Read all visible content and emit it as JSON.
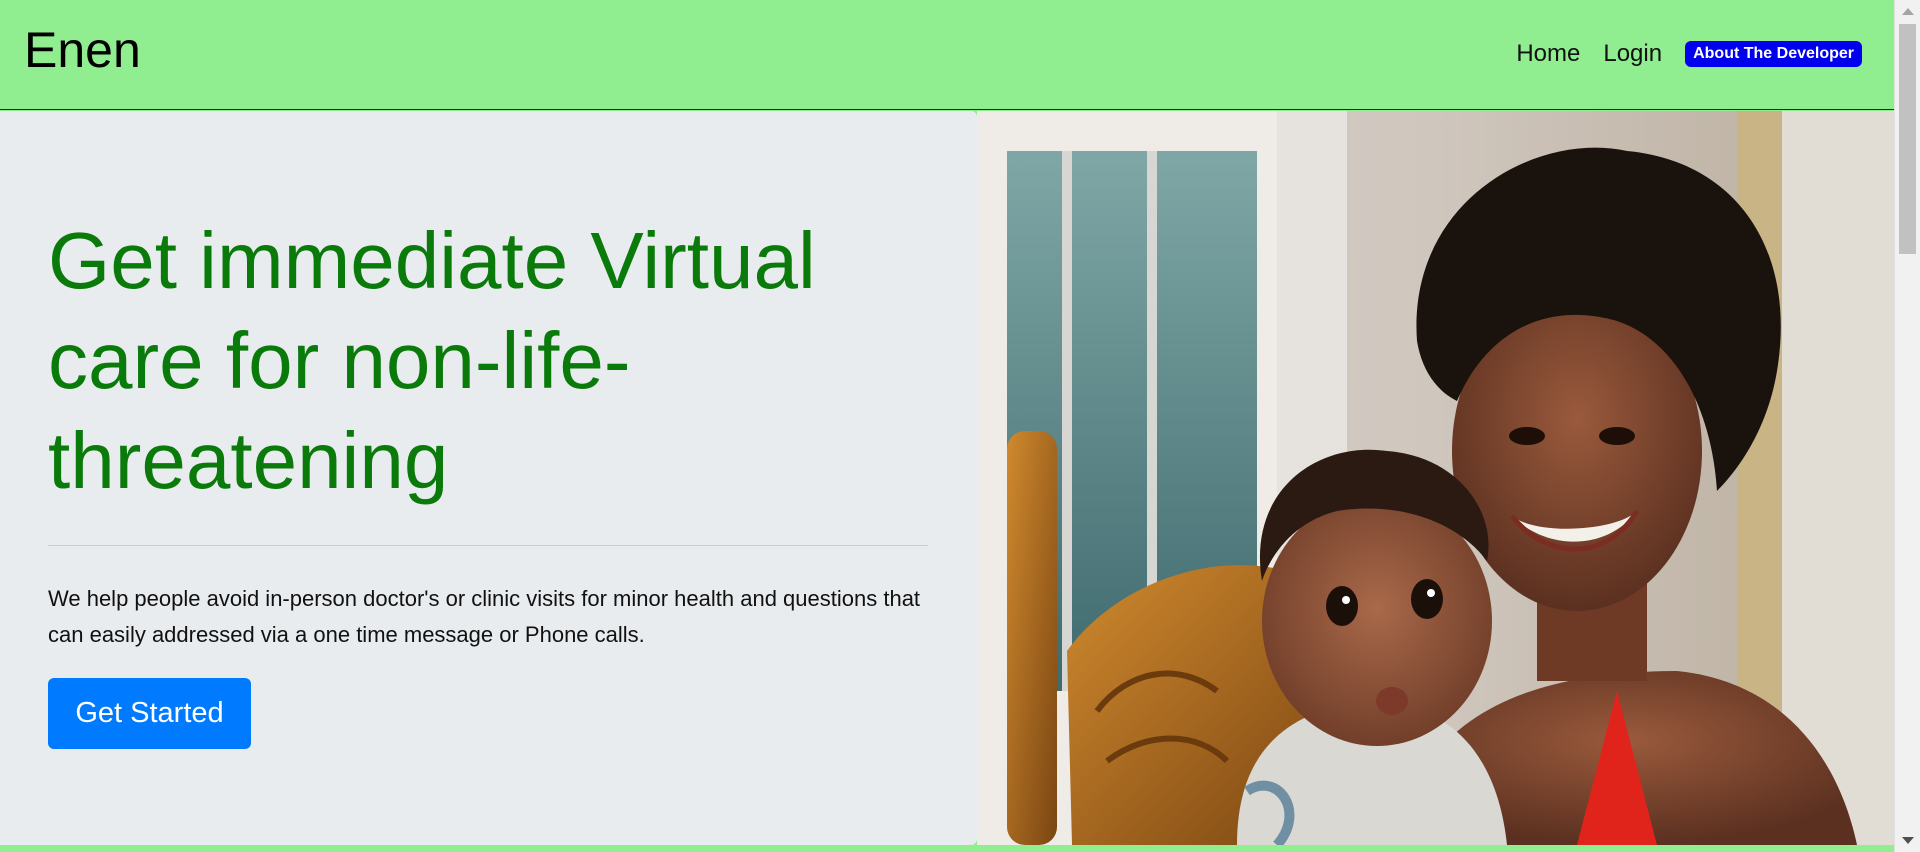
{
  "brand": "Enen",
  "nav": {
    "home": "Home",
    "login": "Login",
    "developer": "About The Developer"
  },
  "hero": {
    "headline": "Get immediate Virtual care for non-life-threatening",
    "lead": "We help people avoid in-person doctor's or clinic visits for minor health and questions that can easily addressed via a one time message or Phone calls.",
    "cta": "Get Started"
  },
  "image": {
    "subject": "mother-and-baby-photo"
  },
  "colors": {
    "navbar_bg": "#90ee90",
    "headline": "#0a7a0a",
    "cta_bg": "#007bff",
    "badge_bg": "#0000ee",
    "hero_bg": "#e9ecef"
  }
}
